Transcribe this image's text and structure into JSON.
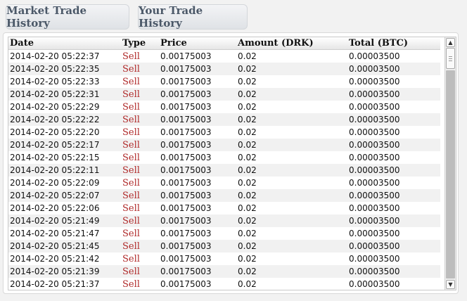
{
  "tabs": [
    {
      "label": "Market Trade History"
    },
    {
      "label": "Your Trade History"
    }
  ],
  "table": {
    "columns": [
      "Date",
      "Type",
      "Price",
      "Amount (DRK)",
      "Total (BTC)"
    ],
    "rows": [
      [
        "2014-02-20 05:22:37",
        "Sell",
        "0.00175003",
        "0.02",
        "0.00003500"
      ],
      [
        "2014-02-20 05:22:35",
        "Sell",
        "0.00175003",
        "0.02",
        "0.00003500"
      ],
      [
        "2014-02-20 05:22:33",
        "Sell",
        "0.00175003",
        "0.02",
        "0.00003500"
      ],
      [
        "2014-02-20 05:22:31",
        "Sell",
        "0.00175003",
        "0.02",
        "0.00003500"
      ],
      [
        "2014-02-20 05:22:29",
        "Sell",
        "0.00175003",
        "0.02",
        "0.00003500"
      ],
      [
        "2014-02-20 05:22:22",
        "Sell",
        "0.00175003",
        "0.02",
        "0.00003500"
      ],
      [
        "2014-02-20 05:22:20",
        "Sell",
        "0.00175003",
        "0.02",
        "0.00003500"
      ],
      [
        "2014-02-20 05:22:17",
        "Sell",
        "0.00175003",
        "0.02",
        "0.00003500"
      ],
      [
        "2014-02-20 05:22:15",
        "Sell",
        "0.00175003",
        "0.02",
        "0.00003500"
      ],
      [
        "2014-02-20 05:22:11",
        "Sell",
        "0.00175003",
        "0.02",
        "0.00003500"
      ],
      [
        "2014-02-20 05:22:09",
        "Sell",
        "0.00175003",
        "0.02",
        "0.00003500"
      ],
      [
        "2014-02-20 05:22:07",
        "Sell",
        "0.00175003",
        "0.02",
        "0.00003500"
      ],
      [
        "2014-02-20 05:22:06",
        "Sell",
        "0.00175003",
        "0.02",
        "0.00003500"
      ],
      [
        "2014-02-20 05:21:49",
        "Sell",
        "0.00175003",
        "0.02",
        "0.00003500"
      ],
      [
        "2014-02-20 05:21:47",
        "Sell",
        "0.00175003",
        "0.02",
        "0.00003500"
      ],
      [
        "2014-02-20 05:21:45",
        "Sell",
        "0.00175003",
        "0.02",
        "0.00003500"
      ],
      [
        "2014-02-20 05:21:42",
        "Sell",
        "0.00175003",
        "0.02",
        "0.00003500"
      ],
      [
        "2014-02-20 05:21:39",
        "Sell",
        "0.00175003",
        "0.02",
        "0.00003500"
      ],
      [
        "2014-02-20 05:21:37",
        "Sell",
        "0.00175003",
        "0.02",
        "0.00003500"
      ]
    ]
  },
  "colors": {
    "sell": "#b02a2a",
    "tab_text": "#4b5868"
  },
  "scrollbar": {
    "up_icon": "arrow-up-icon",
    "down_icon": "arrow-down-icon"
  }
}
